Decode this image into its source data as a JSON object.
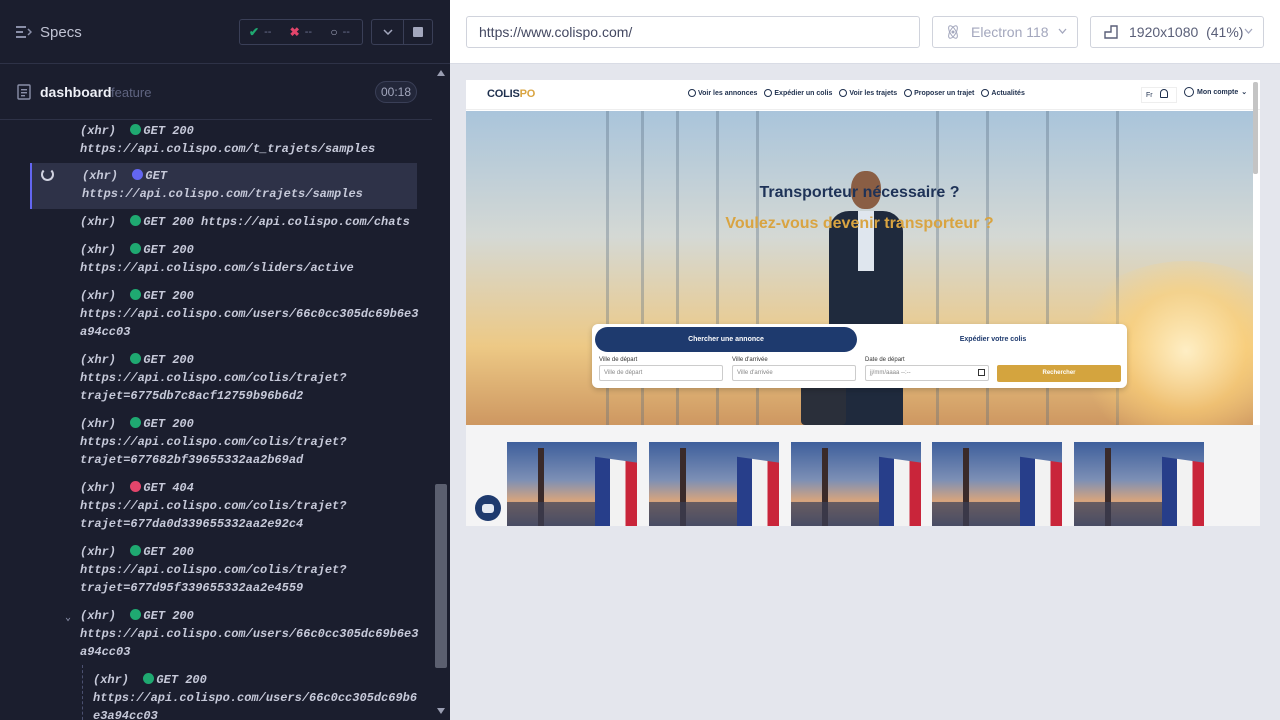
{
  "runner": {
    "specs_label": "Specs",
    "stats": {
      "passed": "--",
      "failed": "--",
      "pending": "--"
    },
    "spec": {
      "name": "dashboard",
      "kind": "feature",
      "time": "00:18"
    }
  },
  "log": [
    {
      "tag": "(xhr)",
      "status": "green",
      "method": "GET 200",
      "url": "https://api.colispo.com/t_trajets/samples",
      "l2": "https://api.colispo.com/t_trajets/samples"
    },
    {
      "tag": "(xhr)",
      "status": "blue",
      "method": "GET",
      "l2": "https://api.colispo.com/trajets/samples"
    },
    {
      "tag": "(xhr)",
      "status": "green",
      "method": "GET 200 https://api.colispo.com/chats"
    },
    {
      "tag": "(xhr)",
      "status": "green",
      "method": "GET 200",
      "l2": "https://api.colispo.com/sliders/active"
    },
    {
      "tag": "(xhr)",
      "status": "green",
      "method": "GET 200",
      "l2": "https://api.colispo.com/users/66c0cc305dc69b6e3",
      "l3": "a94cc03"
    },
    {
      "tag": "(xhr)",
      "status": "green",
      "method": "GET 200",
      "l2": "https://api.colispo.com/colis/trajet?",
      "l3": "trajet=6775db7c8acf12759b96b6d2"
    },
    {
      "tag": "(xhr)",
      "status": "green",
      "method": "GET 200",
      "l2": "https://api.colispo.com/colis/trajet?",
      "l3": "trajet=677682bf39655332aa2b69ad"
    },
    {
      "tag": "(xhr)",
      "status": "red",
      "method": "GET 404",
      "l2": "https://api.colispo.com/colis/trajet?",
      "l3": "trajet=677da0d339655332aa2e92c4"
    },
    {
      "tag": "(xhr)",
      "status": "green",
      "method": "GET 200",
      "l2": "https://api.colispo.com/colis/trajet?",
      "l3": "trajet=677d95f339655332aa2e4559"
    },
    {
      "tag": "(xhr)",
      "status": "green",
      "method": "GET 200",
      "l2": "https://api.colispo.com/users/66c0cc305dc69b6e3",
      "l3": "a94cc03"
    },
    {
      "tag": "(xhr)",
      "status": "green",
      "method": "GET 200",
      "l2": "https://api.colispo.com/users/66c0cc305dc69b6",
      "l3": "e3a94cc03"
    }
  ],
  "browser_bar": {
    "url": "https://www.colispo.com/",
    "browser": "Electron 118",
    "viewport": "1920x1080",
    "scale": "(41%)"
  },
  "site": {
    "logo_a": "COLIS",
    "logo_b": "PO",
    "nav": [
      "Voir les annonces",
      "Expédier un colis",
      "Voir les trajets",
      "Proposer un trajet",
      "Actualités"
    ],
    "lang": "Fr",
    "account": "Mon compte",
    "hero_title": "Transporteur nécessaire ?",
    "hero_sub": "Voulez-vous devenir transporteur ?",
    "tab_search": "Chercher une annonce",
    "tab_send": "Expédier votre colis",
    "label_depart": "Ville de départ",
    "label_arrivee": "Ville d'arrivée",
    "label_date": "Date de départ",
    "ph_depart": "Ville de départ",
    "ph_arrivee": "Ville d'arrivée",
    "ph_date": "jj/mm/aaaa --:--",
    "search_btn": "Rechercher"
  },
  "colors": {
    "accent": "#6366f1",
    "pass": "#1fa971",
    "fail": "#e2456b",
    "brand_navy": "#1e3a6e",
    "brand_gold": "#d4a43e"
  }
}
